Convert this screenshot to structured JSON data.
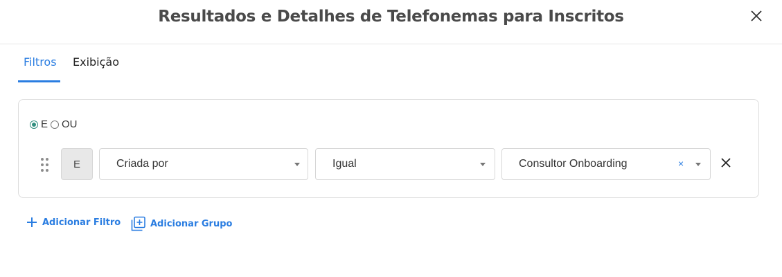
{
  "dialog": {
    "title": "Resultados e Detalhes de Telefonemas para Inscritos"
  },
  "tabs": [
    {
      "label": "Filtros",
      "active": true
    },
    {
      "label": "Exibição",
      "active": false
    }
  ],
  "filter_group": {
    "logic_options": [
      {
        "label": "E",
        "checked": true
      },
      {
        "label": "OU",
        "checked": false
      }
    ],
    "rows": [
      {
        "conjunction": "E",
        "field": "Criada por",
        "operator": "Igual",
        "value": "Consultor Onboarding",
        "clear_symbol": "×"
      }
    ]
  },
  "actions": {
    "add_filter": "Adicionar Filtro",
    "add_group": "Adicionar Grupo"
  },
  "colors": {
    "accent": "#2a7de1",
    "radio_checked": "#2f8f7f",
    "border": "#dcdcdc"
  },
  "icons": [
    "close-icon",
    "drag-handle-icon",
    "chevron-down-icon",
    "plus-icon",
    "add-group-icon"
  ]
}
